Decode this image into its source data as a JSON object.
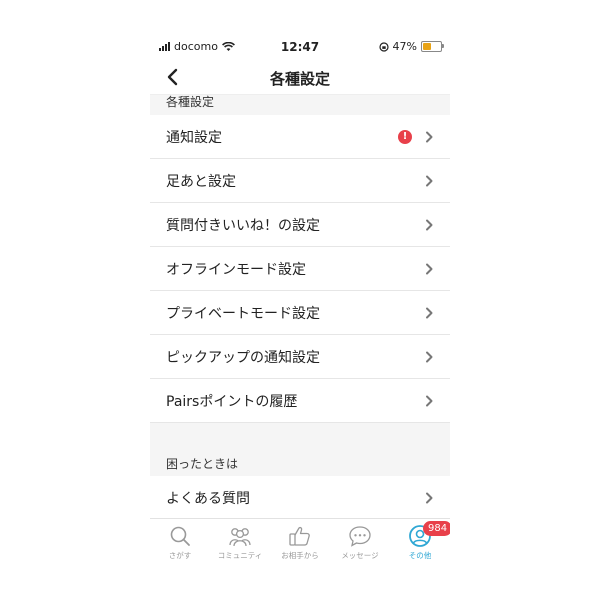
{
  "status_bar": {
    "carrier": "docomo",
    "time": "12:47",
    "battery": "47%",
    "battery_level": 0.47
  },
  "nav": {
    "title": "各種設定"
  },
  "sections": [
    {
      "header": "各種設定",
      "items": [
        {
          "label": "通知設定",
          "alert": "!"
        },
        {
          "label": "足あと設定"
        },
        {
          "label": "質問付きいいね！の設定"
        },
        {
          "label": "オフラインモード設定"
        },
        {
          "label": "プライベートモード設定"
        },
        {
          "label": "ピックアップの通知設定"
        },
        {
          "label": "Pairsポイントの履歴"
        }
      ]
    },
    {
      "header": "困ったときは",
      "items": [
        {
          "label": "よくある質問"
        }
      ]
    }
  ],
  "tabs": [
    {
      "label": "さがす",
      "icon": "search-icon"
    },
    {
      "label": "コミュニティ",
      "icon": "community-icon"
    },
    {
      "label": "お相手から",
      "icon": "thumbs-up-icon"
    },
    {
      "label": "メッセージ",
      "icon": "message-icon"
    },
    {
      "label": "その他",
      "icon": "profile-icon",
      "badge": "984",
      "active": true
    }
  ],
  "colors": {
    "accent": "#2fa7d4",
    "alert": "#e8404a",
    "battery": "#e8a317"
  }
}
